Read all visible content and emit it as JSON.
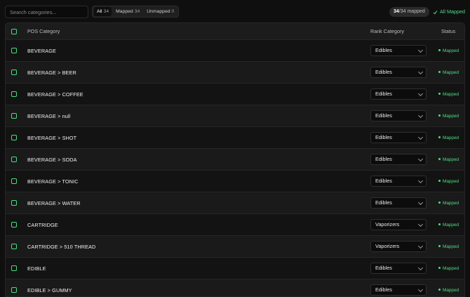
{
  "toolbar": {
    "search_placeholder": "Search categories...",
    "filters": [
      {
        "label": "All",
        "count": "34"
      },
      {
        "label": "Mapped",
        "count": "34"
      },
      {
        "label": "Unmapped",
        "count": "0"
      }
    ],
    "mapped_count_num": "34",
    "mapped_count_rest": "/34 mapped",
    "all_mapped_label": "All Mapped"
  },
  "table": {
    "headers": {
      "category": "POS Category",
      "rank": "Rank Category",
      "status": "Status"
    },
    "rows": [
      {
        "name": "BEVERAGE",
        "rank": "Edibles",
        "status": "Mapped"
      },
      {
        "name": "BEVERAGE > BEER",
        "rank": "Edibles",
        "status": "Mapped"
      },
      {
        "name": "BEVERAGE > COFFEE",
        "rank": "Edibles",
        "status": "Mapped"
      },
      {
        "name": "BEVERAGE > null",
        "rank": "Edibles",
        "status": "Mapped"
      },
      {
        "name": "BEVERAGE > SHOT",
        "rank": "Edibles",
        "status": "Mapped"
      },
      {
        "name": "BEVERAGE > SODA",
        "rank": "Edibles",
        "status": "Mapped"
      },
      {
        "name": "BEVERAGE > TONIC",
        "rank": "Edibles",
        "status": "Mapped"
      },
      {
        "name": "BEVERAGE > WATER",
        "rank": "Edibles",
        "status": "Mapped"
      },
      {
        "name": "CARTRIDGE",
        "rank": "Vaporizers",
        "status": "Mapped"
      },
      {
        "name": "CARTRIDGE > 510 THREAD",
        "rank": "Vaporizers",
        "status": "Mapped"
      },
      {
        "name": "EDIBLE",
        "rank": "Edibles",
        "status": "Mapped"
      },
      {
        "name": "EDIBLE > GUMMY",
        "rank": "Edibles",
        "status": "Mapped"
      }
    ]
  },
  "colors": {
    "accent": "#4ade80",
    "background": "#0f0f0f"
  }
}
